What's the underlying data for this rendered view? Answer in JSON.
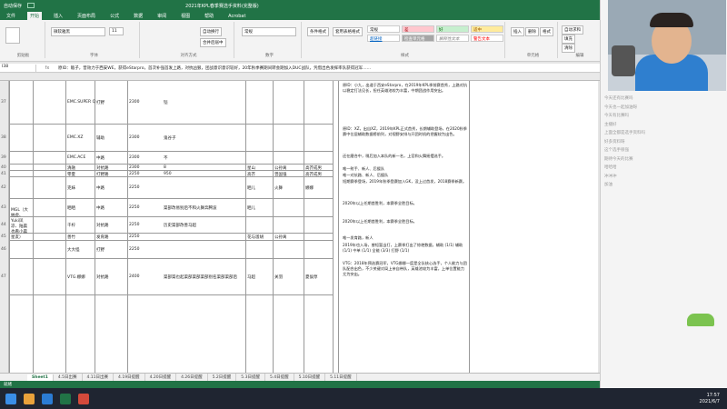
{
  "titlebar": {
    "autosave": "自动保存",
    "title": "2021年KPL春季赛选手资料(完整版)"
  },
  "tabs": [
    "文件",
    "开始",
    "插入",
    "页面布局",
    "公式",
    "数据",
    "审阅",
    "视图",
    "帮助",
    "Acrobat"
  ],
  "ribbon": {
    "font_name": "微软雅黑",
    "font_size": "11",
    "wrap": "自动换行",
    "merge": "合并后居中",
    "number_format": "常规",
    "cond_format": "条件格式",
    "table_format": "套用表格格式",
    "insert": "插入",
    "delete": "删除",
    "format": "格式",
    "autosum": "自动求和",
    "fill": "填充",
    "clear": "清除",
    "sort": "排序和筛选",
    "find": "查找和选择",
    "styles": [
      "常规",
      "差",
      "好",
      "适中",
      "超链接",
      "检查单元格",
      "解释性文本",
      "警告文本"
    ],
    "groups": [
      "剪贴板",
      "字体",
      "对齐方式",
      "数字",
      "样式",
      "单元格",
      "编辑"
    ]
  },
  "formula_bar": {
    "name_box": "I38",
    "fx": "fx",
    "text": "原ID：敌子，曾效力于西安WE，获得eStarpro，首次补强首发上路，对抗凶狠，团战意识意识较好，20年秋季赛期间转会期加入DUC战队，凭借出色发挥率队获得冠军……"
  },
  "rows": [
    {
      "num": "37",
      "team": "",
      "player": "EMC.SUPER Q",
      "pos": "打野",
      "price": "2300",
      "hero": "铠"
    },
    {
      "num": "38",
      "team": "",
      "player": "EMC.XZ",
      "pos": "辅助",
      "price": "2300",
      "hero": "鬼谷子"
    },
    {
      "num": "39",
      "team": "",
      "player": "EMC.ACE",
      "pos": "中路",
      "price": "2300",
      "hero": "不"
    },
    {
      "num": "40",
      "team": "",
      "player": "清融",
      "pos": "对抗路",
      "price": "2300",
      "hero": "8"
    },
    {
      "num": "41",
      "team": "",
      "player": "零夏",
      "pos": "打野路",
      "price": "2250",
      "hero": "950"
    },
    {
      "num": "42",
      "team": "",
      "player": "克妹",
      "pos": "中路",
      "price": "2250",
      "hero": ""
    },
    {
      "num": "43",
      "team": "MGL（大纳虎、Yuki凤凉、陆晨也看小晨星友）",
      "player": "晒晒",
      "pos": "中路",
      "price": "2250",
      "hero": "渠部改易别后不和火舞奔腾波"
    },
    {
      "num": "44",
      "team": "",
      "player": "千柠",
      "pos": "对抗路",
      "price": "2250",
      "hero": "历史渠部改善马超"
    },
    {
      "num": "45",
      "team": "",
      "player": "善竹",
      "pos": "发育路",
      "price": "2250",
      "hero": ""
    },
    {
      "num": "46",
      "team": "",
      "player": "大大怪",
      "pos": "打野",
      "price": "2250",
      "hero": ""
    },
    {
      "num": "47",
      "team": "",
      "player": "VTG.娜娜",
      "pos": "对抗路",
      "price": "2400",
      "hero": "渠部渠也起渠部渠部渠部别名渠部渠部后"
    }
  ],
  "col_extra": [
    [
      "",
      "",
      ""
    ],
    [
      "",
      "",
      ""
    ],
    [
      "",
      "",
      ""
    ],
    [
      "星山",
      "公孙离",
      "高芥成男"
    ],
    [
      "高芥",
      "曾国强",
      "高芥成男"
    ],
    [
      "晒儿",
      "火舞",
      "娜娜"
    ],
    [
      "晒儿",
      "",
      ""
    ],
    [
      "",
      "",
      ""
    ],
    [
      "花与滥胡",
      "公孙离",
      ""
    ],
    [
      "",
      "",
      ""
    ],
    [
      "马超",
      "关羽",
      "夏侯惇"
    ]
  ],
  "notes": [
    "原ID：小九，出道于西安eStarpro，在2019年KPL季前赛首秀，上路对抗以稳定打法见长，担任英雄池较为丰富，中期团战作用突出。",
    "原ID：XZ，出自XZ，2019年KPL正式首秀，长期辅助登场，在2020秋季赛中位居辅助数据榜前列，对视野安排与开团时机的把握较为出色。",
    "还在磨合中，稍后加入本队的新一名，上官和火舞摇摆选手。",
    "唯一射手、新人、后援队",
    "唯一对抗路、新人、后援队",
    "短期赛季登场，2019年秋季登赛加入GK，没上过首发，2018赛季新赛。",
    "2020年以上任期首胜利，本赛季全胜目标。",
    "2020年以上任期首胜利，本赛季全胜目标。",
    "唯一发育路，新人",
    "2019年也入场，曾短暂当打，上赛季打出了惊艳数据，辅助 (1/1) 辅助 (1/1) 中单 (1/1) 全能 (3/3) 打野 (1/1)",
    "VTG：2018年预选赛冠军，VTG娜娜一度是全队核心选手，个人能力与团队配合出色，不少关键对局上亲自带队，英雄池较为丰富，上单位置能力尤为突出。"
  ],
  "sheet_tabs": [
    "Sheet1",
    "4.5日出赛",
    "4.11日出赛",
    "4.19日提醒",
    "4.20日提醒",
    "4.26日提醒",
    "5.2日提醒",
    "5.3日提醒",
    "5.4日提醒",
    "5.10日提醒",
    "5.11日提醒"
  ],
  "status": "就绪",
  "clock": {
    "time": "17:57",
    "date": "2021/6/7"
  },
  "chat": [
    {
      "user": "",
      "msg": ""
    },
    {
      "user": "",
      "msg": "今天还有比赛吗"
    },
    {
      "user": "",
      "msg": "今天也一起加油呀"
    },
    {
      "user": "",
      "msg": "今天有比赛吗"
    },
    {
      "user": "",
      "msg": "主播好"
    },
    {
      "user": "",
      "msg": "上面全都是选手资料吗"
    },
    {
      "user": "",
      "msg": "好多资料呀"
    },
    {
      "user": "",
      "msg": "这个选手很强"
    },
    {
      "user": "",
      "msg": "期待今天的比赛"
    },
    {
      "user": "",
      "msg": "哈哈哈"
    },
    {
      "user": "",
      "msg": "冲冲冲"
    },
    {
      "user": "",
      "msg": "加油"
    }
  ]
}
